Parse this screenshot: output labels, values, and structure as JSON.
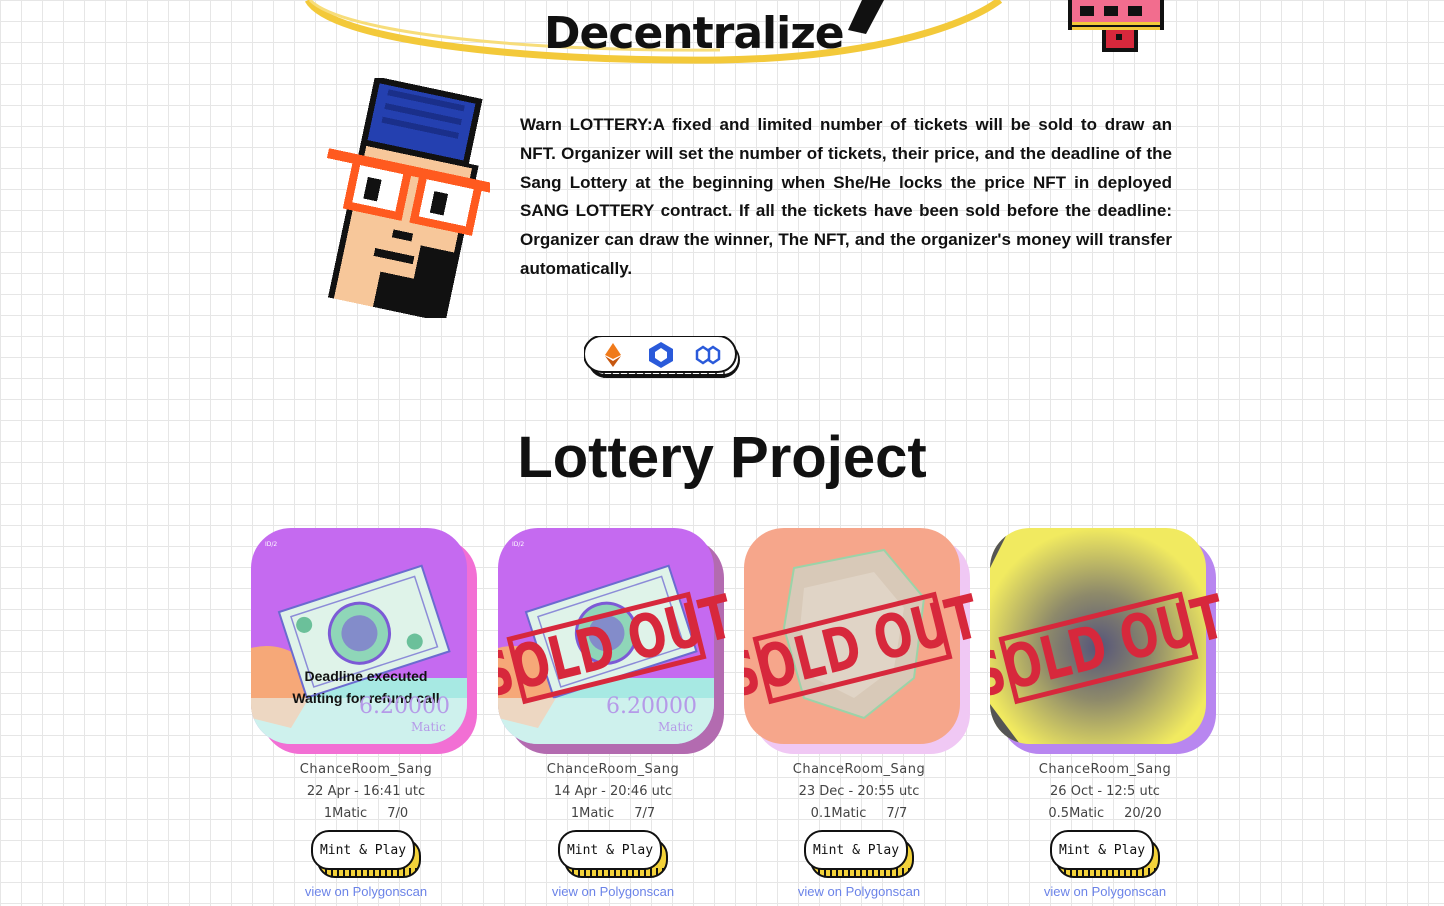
{
  "hero": {
    "title": "Decentralize"
  },
  "intro": {
    "text": "Warn LOTTERY:A fixed and limited number of tickets will be sold to draw an NFT. Organizer will set the number of tickets, their price, and the deadline of the Sang Lottery at the beginning when She/He locks the price NFT in deployed SANG LOTTERY contract. If all the tickets have been sold before the deadline: Organizer can draw the winner, The NFT, and the organizer's money will transfer automatically."
  },
  "chains": {
    "icons": [
      "ethereum-icon",
      "chainlink-icon",
      "polygon-icon"
    ]
  },
  "section": {
    "title": "Lottery Project"
  },
  "cards": [
    {
      "theme": "purple-bill",
      "status_line1": "Deadline executed",
      "status_line2": "Waiting for refund call",
      "name": "ChanceRoom_Sang",
      "date": "22 Apr - 16:41 utc",
      "price": "1Matic",
      "tickets": "7/0",
      "mint_label": "Mint & Play",
      "link_label": "view on Polygonscan",
      "bill_value": "6.20000",
      "bill_unit": "Matic",
      "sold_out": false
    },
    {
      "theme": "purple-bill",
      "name": "ChanceRoom_Sang",
      "date": "14 Apr - 20:46 utc",
      "price": "1Matic",
      "tickets": "7/7",
      "mint_label": "Mint & Play",
      "link_label": "view on Polygonscan",
      "bill_value": "6.20000",
      "bill_unit": "Matic",
      "sold_out": true,
      "stamp_text": "SOLD OUT"
    },
    {
      "theme": "salmon-stone",
      "name": "ChanceRoom_Sang",
      "date": "23 Dec - 20:55 utc",
      "price": "0.1Matic",
      "tickets": "7/7",
      "mint_label": "Mint & Play",
      "link_label": "view on Polygonscan",
      "sold_out": true,
      "stamp_text": "SOLD OUT"
    },
    {
      "theme": "yellow-blur",
      "name": "ChanceRoom_Sang",
      "date": "26 Oct - 12:5 utc",
      "price": "0.5Matic",
      "tickets": "20/20",
      "mint_label": "Mint & Play",
      "link_label": "view on Polygonscan",
      "sold_out": true,
      "stamp_text": "SOLD OUT"
    }
  ],
  "colors": {
    "accent_yellow": "#f3c93a",
    "stamp_red": "#d7283c",
    "card_purple": "#c56af0",
    "card_salmon": "#f6a68b",
    "card_yellow": "#f1ea60",
    "link_blue": "#6b83e8"
  }
}
